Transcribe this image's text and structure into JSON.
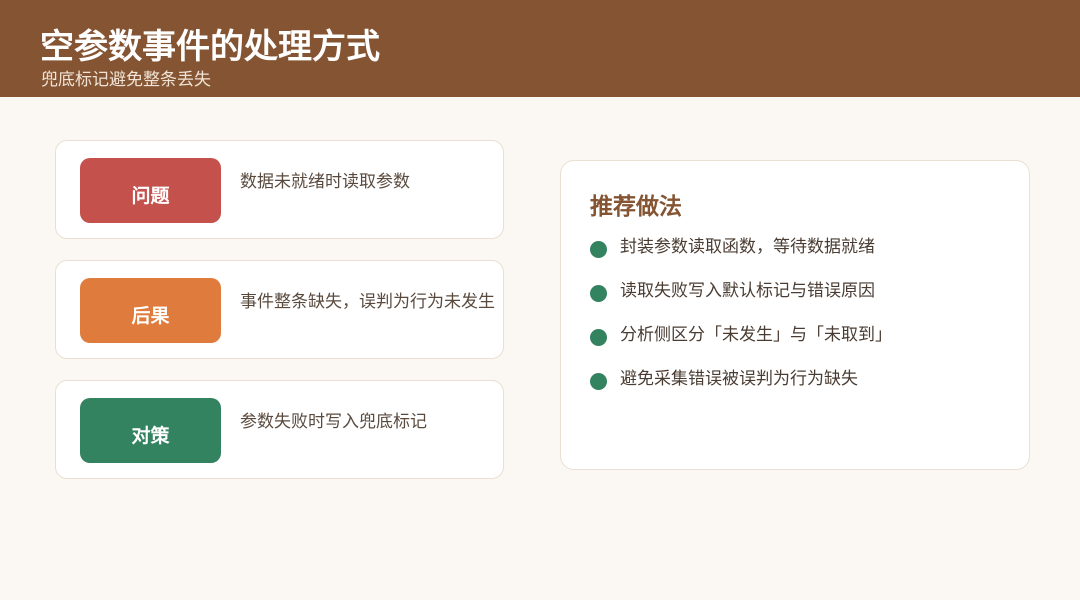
{
  "header": {
    "title": "空参数事件的处理方式",
    "subtitle": "兜底标记避免整条丢失"
  },
  "cards": [
    {
      "tag": "问题",
      "text": "数据未就绪时读取参数",
      "color": "#C5514C"
    },
    {
      "tag": "后果",
      "text": "事件整条缺失，误判为行为未发生",
      "color": "#DF7B3C"
    },
    {
      "tag": "对策",
      "text": "参数失败时写入兜底标记",
      "color": "#338260"
    }
  ],
  "panel": {
    "title": "推荐做法",
    "bullets": [
      "封装参数读取函数，等待数据就绪",
      "读取失败写入默认标记与错误原因",
      "分析侧区分「未发生」与「未取到」",
      "避免采集错误被误判为行为缺失"
    ]
  },
  "colors": {
    "header_bg": "#845433",
    "page_bg": "#FBF7F2",
    "accent_green": "#338260"
  }
}
